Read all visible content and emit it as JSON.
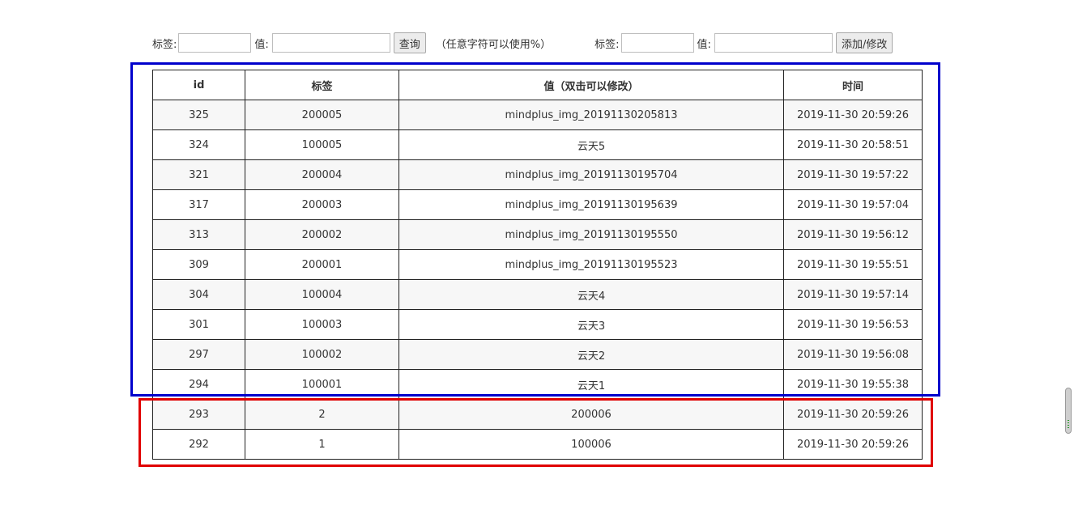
{
  "toolbar": {
    "tag_label": "标签:",
    "value_label": "值:",
    "query_button": "查询",
    "hint": "（任意字符可以使用%）",
    "tag_label_2": "标签:",
    "value_label_2": "值:",
    "add_button": "添加/修改",
    "tag_input": "",
    "value_input": "",
    "tag_input_2": "",
    "value_input_2": ""
  },
  "table": {
    "headers": [
      "id",
      "标签",
      "值（双击可以修改）",
      "时间"
    ],
    "rows": [
      [
        "325",
        "200005",
        "mindplus_img_20191130205813",
        "2019-11-30 20:59:26"
      ],
      [
        "324",
        "100005",
        "云天5",
        "2019-11-30 20:58:51"
      ],
      [
        "321",
        "200004",
        "mindplus_img_20191130195704",
        "2019-11-30 19:57:22"
      ],
      [
        "317",
        "200003",
        "mindplus_img_20191130195639",
        "2019-11-30 19:57:04"
      ],
      [
        "313",
        "200002",
        "mindplus_img_20191130195550",
        "2019-11-30 19:56:12"
      ],
      [
        "309",
        "200001",
        "mindplus_img_20191130195523",
        "2019-11-30 19:55:51"
      ],
      [
        "304",
        "100004",
        "云天4",
        "2019-11-30 19:57:14"
      ],
      [
        "301",
        "100003",
        "云天3",
        "2019-11-30 19:56:53"
      ],
      [
        "297",
        "100002",
        "云天2",
        "2019-11-30 19:56:08"
      ],
      [
        "294",
        "100001",
        "云天1",
        "2019-11-30 19:55:38"
      ],
      [
        "293",
        "2",
        "200006",
        "2019-11-30 20:59:26"
      ],
      [
        "292",
        "1",
        "100006",
        "2019-11-30 20:59:26"
      ]
    ]
  },
  "colors": {
    "blue_box": "#0000cc",
    "red_box": "#e00000"
  }
}
